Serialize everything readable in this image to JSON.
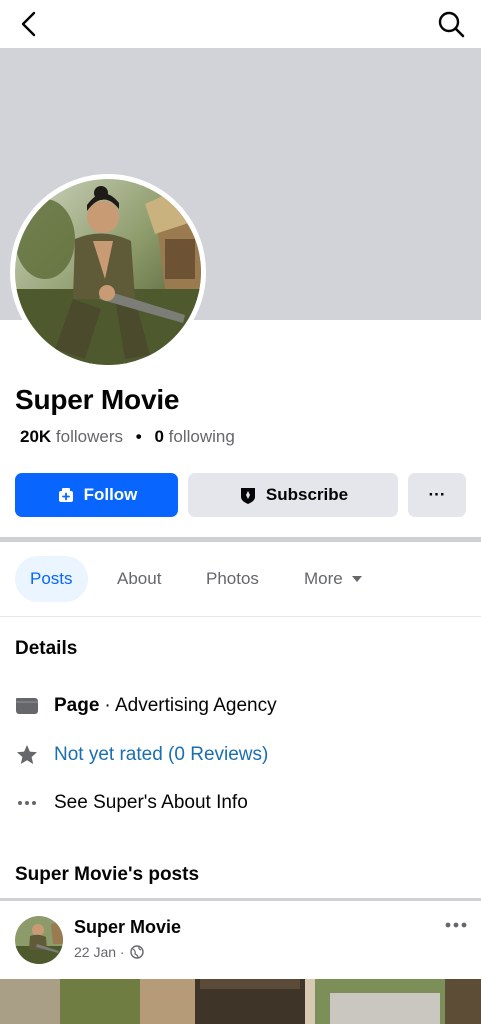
{
  "topbar": {
    "back_icon": "chevron-left-icon",
    "search_icon": "search-icon"
  },
  "colors": {
    "accent": "#0866ff",
    "cover": "#d1d3d8",
    "button_gray": "#e4e6eb",
    "link": "#1a6fb0",
    "muted": "#65676b"
  },
  "profile": {
    "name": "Super Movie",
    "followers_count": "20K",
    "followers_label": "followers",
    "separator": "•",
    "following_count": "0",
    "following_label": "following"
  },
  "actions": {
    "follow": "Follow",
    "subscribe": "Subscribe",
    "more": "···"
  },
  "tabs": [
    {
      "label": "Posts",
      "active": true
    },
    {
      "label": "About"
    },
    {
      "label": "Photos"
    },
    {
      "label": "More"
    }
  ],
  "details": {
    "title": "Details",
    "page_strong": "Page",
    "page_category": "· Advertising Agency",
    "rating": "Not yet rated (0 Reviews)",
    "about": "See Super's About Info"
  },
  "posts": {
    "section_title": "Super Movie's posts",
    "items": [
      {
        "author": "Super Movie",
        "date": "22 Jan ·",
        "privacy_icon": "globe-icon"
      }
    ]
  }
}
